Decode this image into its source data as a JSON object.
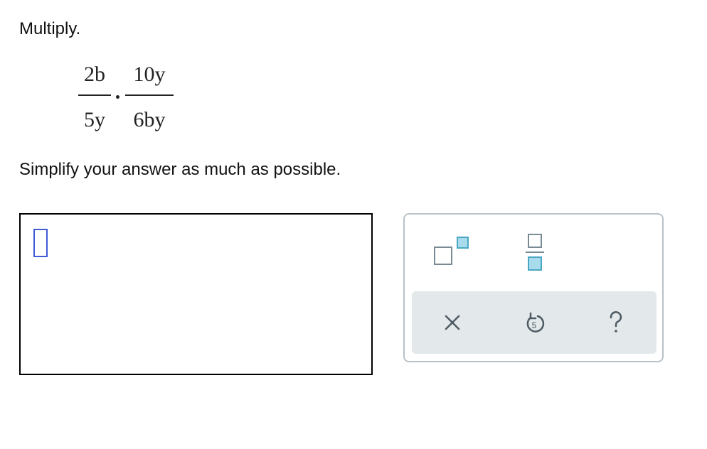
{
  "question": {
    "instruction": "Multiply.",
    "expression": {
      "fraction1": {
        "numerator": "2b",
        "denominator": "5y"
      },
      "operator": "·",
      "fraction2": {
        "numerator": "10y",
        "denominator": "6by"
      }
    },
    "simplify_text": "Simplify your answer as much as possible."
  },
  "answer": {
    "value": ""
  },
  "toolbar": {
    "tools": [
      {
        "name": "exponent",
        "icon": "exponent-template-icon"
      },
      {
        "name": "fraction",
        "icon": "fraction-template-icon"
      }
    ],
    "actions": [
      {
        "name": "clear",
        "icon": "clear-icon"
      },
      {
        "name": "undo",
        "icon": "undo-icon"
      },
      {
        "name": "help",
        "icon": "help-icon"
      }
    ]
  },
  "colors": {
    "cursor": "#3f5bd6",
    "template_box_gray": "#7a8a94",
    "template_box_accent": "#4aa8c4",
    "toolbar_border": "#b8c2c8",
    "action_bar_bg": "#e3e8ea",
    "action_icon": "#4d5a63"
  }
}
